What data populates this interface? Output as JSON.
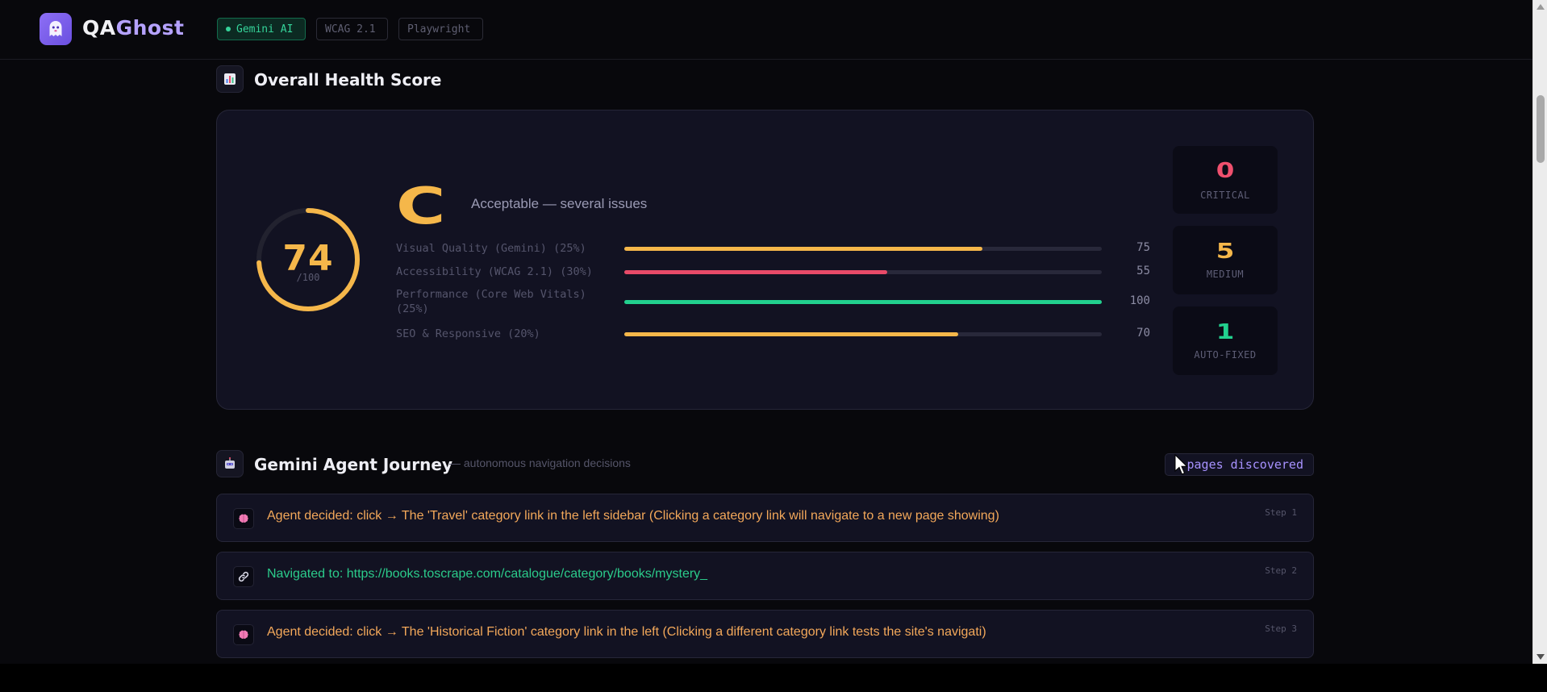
{
  "nav": {
    "brand_part1": "QA",
    "brand_part2": "Ghost",
    "badges": [
      "Gemini AI",
      "WCAG 2.1",
      "Playwright"
    ]
  },
  "health": {
    "section_title": "Overall Health Score",
    "score": "74",
    "score_max": "/100",
    "score_fraction": 0.74,
    "grade": "C",
    "grade_desc": "Acceptable — several issues",
    "metrics": [
      {
        "label": "Visual Quality (Gemini) (25%)",
        "value": "75",
        "percent": 75,
        "color": "#f5b74a"
      },
      {
        "label": "Accessibility (WCAG 2.1) (30%)",
        "value": "55",
        "percent": 55,
        "color": "#e84a68"
      },
      {
        "label": "Performance (Core Web Vitals) (25%)",
        "value": "100",
        "percent": 100,
        "color": "#22d08e"
      },
      {
        "label": "SEO & Responsive (20%)",
        "value": "70",
        "percent": 70,
        "color": "#f5b74a"
      }
    ],
    "stats": [
      {
        "number": "0",
        "label": "CRITICAL",
        "color": "#f0506e"
      },
      {
        "number": "5",
        "label": "MEDIUM",
        "color": "#f5b74a"
      },
      {
        "number": "1",
        "label": "AUTO-FIXED",
        "color": "#22d08e"
      }
    ],
    "colors": {
      "ring": "#f5b74a",
      "ring_track": "#22222f"
    }
  },
  "journey": {
    "section_title": "Gemini Agent Journey",
    "subtitle": "— autonomous navigation decisions",
    "pages_badge": "pages discovered",
    "steps": [
      {
        "icon": "brain-icon",
        "text": "Agent decided: click → The 'Travel' category link in the left sidebar (Clicking a category link will navigate to a new page showing)",
        "step": "Step 1",
        "kind": "decide"
      },
      {
        "icon": "link-icon",
        "text": "Navigated to: https://books.toscrape.com/catalogue/category/books/mystery_",
        "step": "Step 2",
        "kind": "nav"
      },
      {
        "icon": "brain-icon",
        "text": "Agent decided: click → The 'Historical Fiction' category link in the left (Clicking a different category link tests the site's navigati)",
        "step": "Step 3",
        "kind": "decide"
      }
    ]
  }
}
